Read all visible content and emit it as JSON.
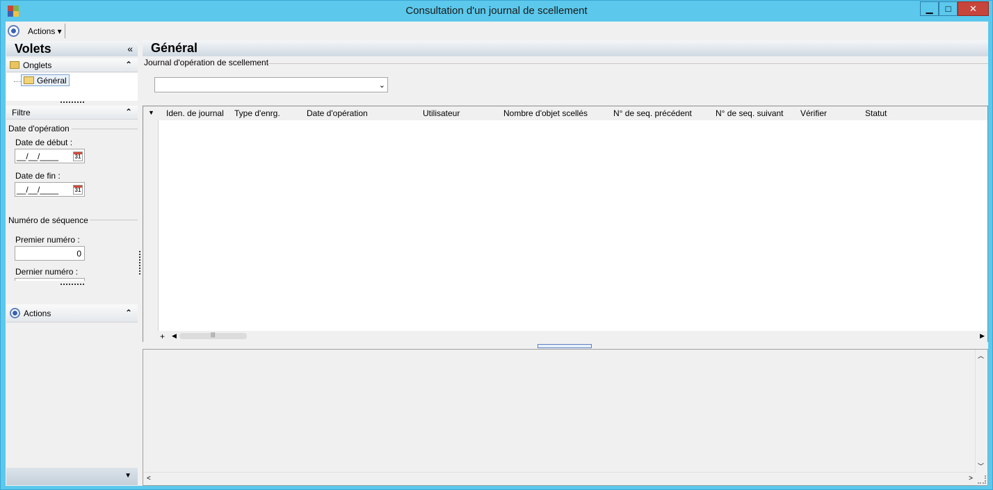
{
  "window": {
    "title": "Consultation d'un journal de scellement",
    "controls": {
      "minimize": "▁",
      "maximize": "□",
      "close": "✕"
    }
  },
  "toolbar": {
    "actions_label": "Actions ▾"
  },
  "volets": {
    "title": "Volets",
    "collapse": "«",
    "onglets": {
      "title": "Onglets",
      "toggle": "⌃",
      "items": [
        {
          "label": "Général"
        }
      ]
    },
    "filtre": {
      "title": "Filtre",
      "toggle": "⌃",
      "date_group": "Date d'opération",
      "start_label": "Date de début :",
      "start_value": "__/__/____",
      "end_label": "Date de fin :",
      "end_value": "__/__/____",
      "calendar_day": "31",
      "seq_group": "Numéro de séquence",
      "first_label": "Premier numéro :",
      "first_value": "0",
      "last_label": "Dernier numéro :"
    },
    "actions": {
      "title": "Actions",
      "toggle": "⌃"
    },
    "bottom_toggle": "▼"
  },
  "main": {
    "title": "Général",
    "journal_label": "Journal d'opération de scellement",
    "journal_value": "",
    "journal_arrow": "⌄",
    "grid": {
      "dropdown": "▼",
      "columns": [
        "Iden. de journal",
        "Type d'enrg.",
        "Date d'opération",
        "Utilisateur",
        "Nombre d'objet scellés",
        "N° de seq. précédent",
        "N° de seq. suivant",
        "Vérifier",
        "Statut"
      ],
      "rows": [],
      "add": "+",
      "scroll_left": "◀",
      "scroll_right": "▶"
    },
    "detail": {
      "scroll_up": "︿",
      "scroll_down": "﹀",
      "scroll_left": "<",
      "scroll_right": ">"
    }
  },
  "colors": {
    "title_bar": "#5bc8ec",
    "close_button": "#c7453b",
    "panel_background": "#f0f0f0",
    "header_gradient_end": "#cfd9e2"
  }
}
